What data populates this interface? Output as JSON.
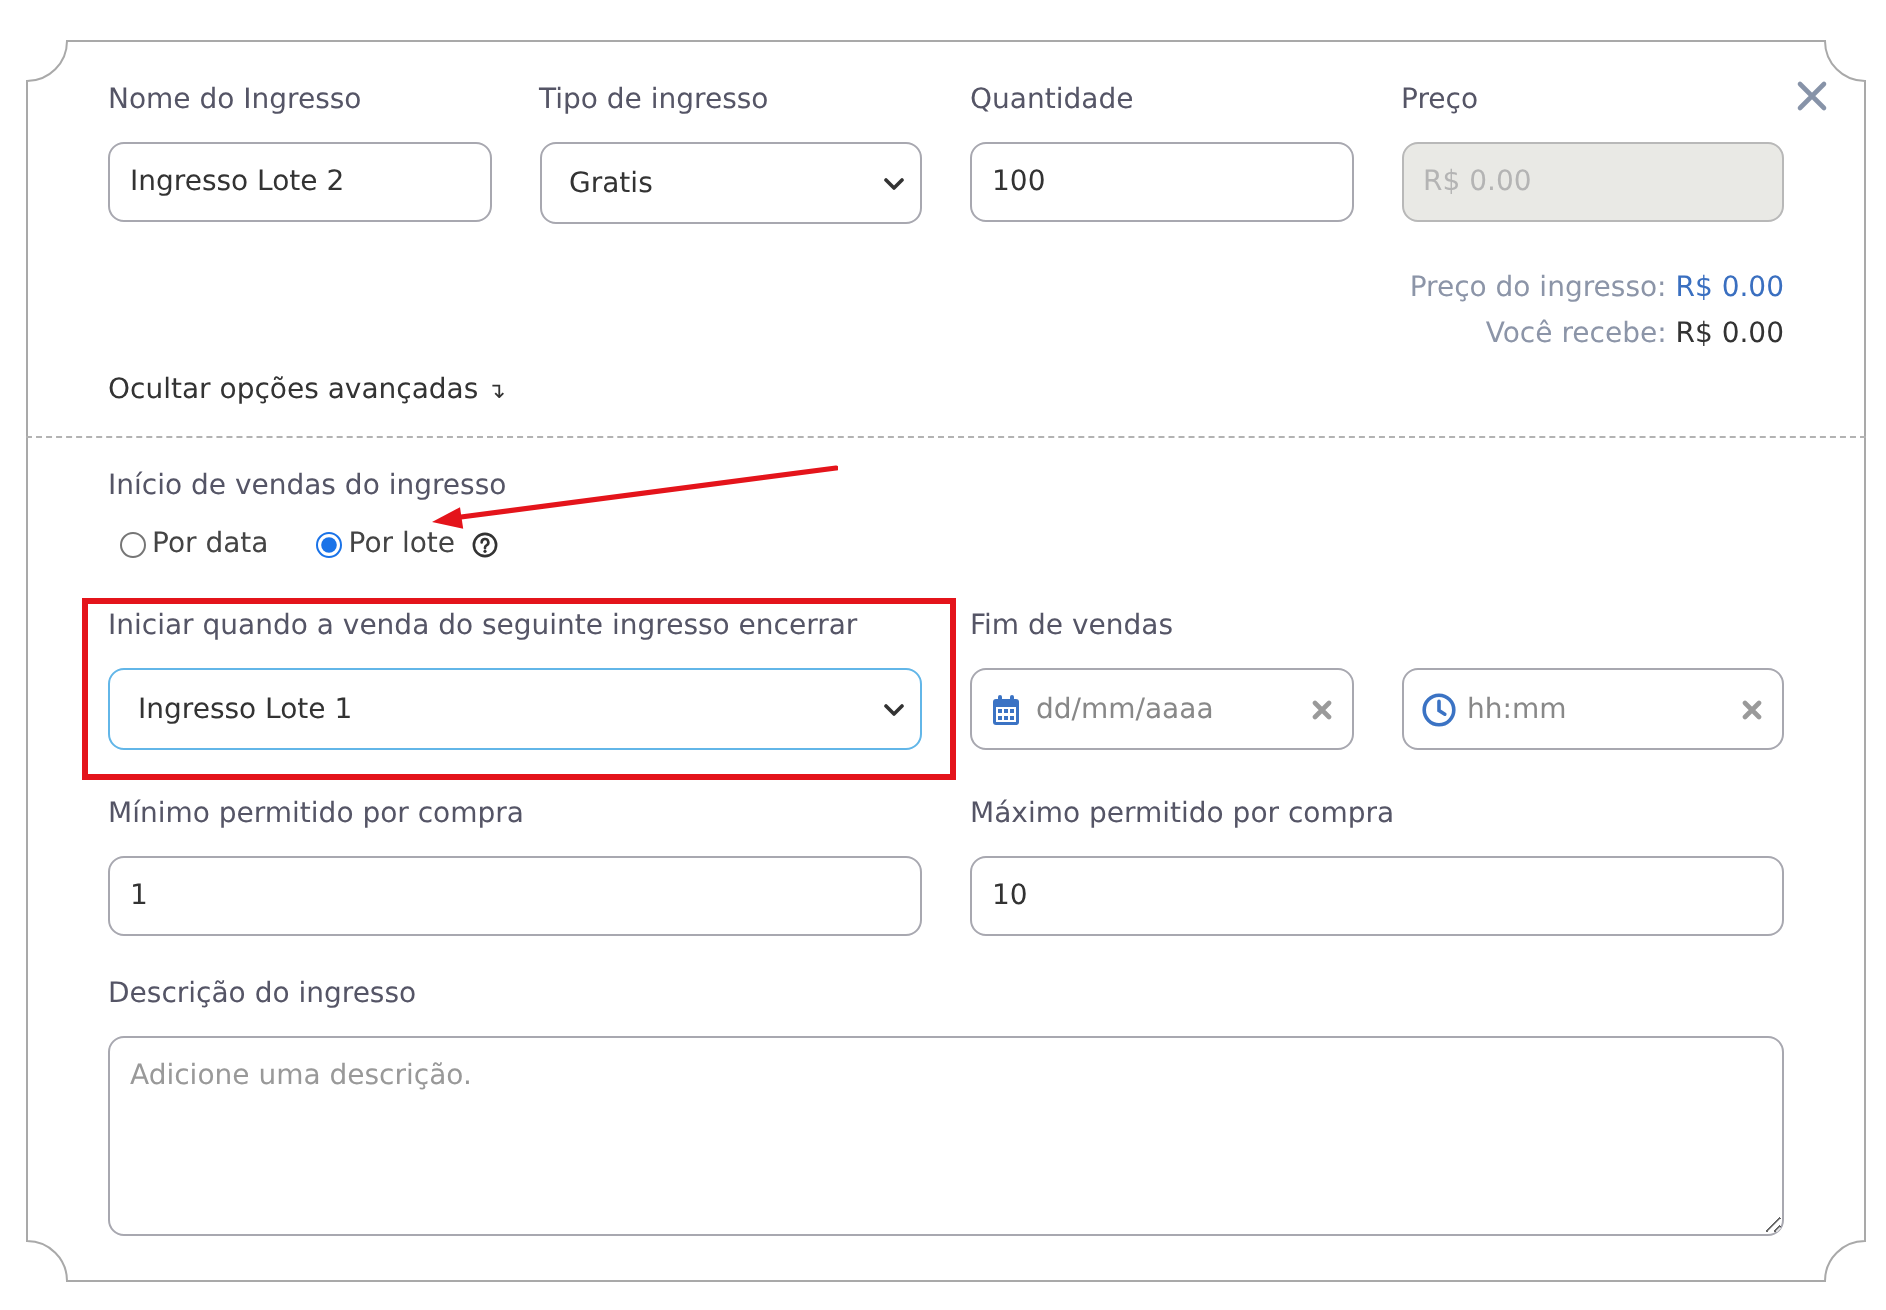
{
  "dialog": {
    "closable": true
  },
  "ticket_fields": [
    {
      "label": "Nome do Ingresso",
      "kind": "text",
      "value": "Ingresso Lote 2",
      "disabled": false
    },
    {
      "label": "Tipo de ingresso",
      "kind": "select",
      "value": "Gratis",
      "disabled": false
    },
    {
      "label": "Quantidade",
      "kind": "text",
      "value": "100",
      "disabled": false
    },
    {
      "label": "Preço",
      "kind": "text",
      "placeholder": "R$ 0.00",
      "disabled": true
    }
  ],
  "price_summary": [
    {
      "label": "Preço do ingresso:",
      "value": "R$ 0.00",
      "kind": "accent"
    },
    {
      "label": "Você recebe:",
      "value": "R$ 0.00",
      "kind": "plain"
    }
  ],
  "advanced_toggle": {
    "label": "Ocultar opções avançadas",
    "glyph": "↴",
    "expanded": true
  },
  "sales_start": {
    "label": "Início de vendas do ingresso",
    "options": [
      {
        "label": "Por data",
        "selected": false,
        "help": false,
        "annotated": false
      },
      {
        "label": "Por lote",
        "selected": true,
        "help": true,
        "annotated": true
      }
    ]
  },
  "start_after": {
    "label": "Iniciar quando a venda do seguinte ingresso encerrar",
    "value": "Ingresso Lote 1",
    "focused": true,
    "annotated": true
  },
  "sales_end": {
    "label": "Fim de vendas",
    "fields": [
      {
        "kind": "date",
        "placeholder": "dd/mm/aaaa"
      },
      {
        "kind": "time",
        "placeholder": "hh:mm"
      }
    ]
  },
  "purchase_limits": [
    {
      "label": "Mínimo permitido por compra",
      "value": "1"
    },
    {
      "label": "Máximo permitido por compra",
      "value": "10"
    }
  ],
  "description": {
    "label": "Descrição do ingresso",
    "placeholder": "Adicione uma descrição."
  }
}
